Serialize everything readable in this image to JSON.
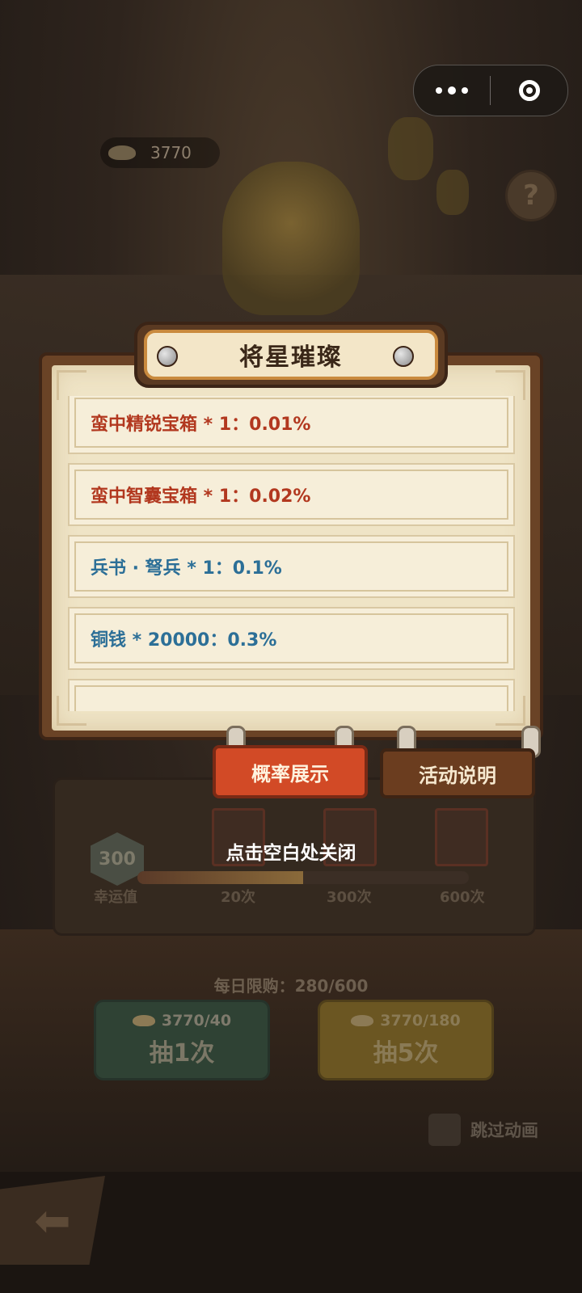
{
  "topbar": {
    "currency_value": "3770",
    "help_label": "?"
  },
  "popup": {
    "title": "将星璀璨",
    "items": [
      {
        "text": "蛮中精锐宝箱 * 1：0.01%",
        "color": "red"
      },
      {
        "text": "蛮中智囊宝箱 * 1：0.02%",
        "color": "red"
      },
      {
        "text": "兵书 · 弩兵 * 1：0.1%",
        "color": "blue"
      },
      {
        "text": "铜钱 * 20000：0.3%",
        "color": "blue"
      },
      {
        "text": "",
        "color": "blue"
      }
    ],
    "tabs": {
      "probability": "概率展示",
      "activity_info": "活动说明"
    },
    "close_hint": "点击空白处关闭"
  },
  "luck": {
    "value": "300",
    "label": "幸运值",
    "milestones": [
      "20次",
      "300次",
      "600次"
    ],
    "progress_fraction": 0.5
  },
  "draw": {
    "daily_limit": "每日限购：280/600",
    "once_cost": "3770/40",
    "once_label": "抽1次",
    "five_cost": "3770/180",
    "five_label": "抽5次"
  },
  "skip_animation": "跳过动画",
  "colors": {
    "title_border": "#c98a3e",
    "active_tab": "#d24a26",
    "red_text": "#b2381f",
    "blue_text": "#2c6f97"
  }
}
